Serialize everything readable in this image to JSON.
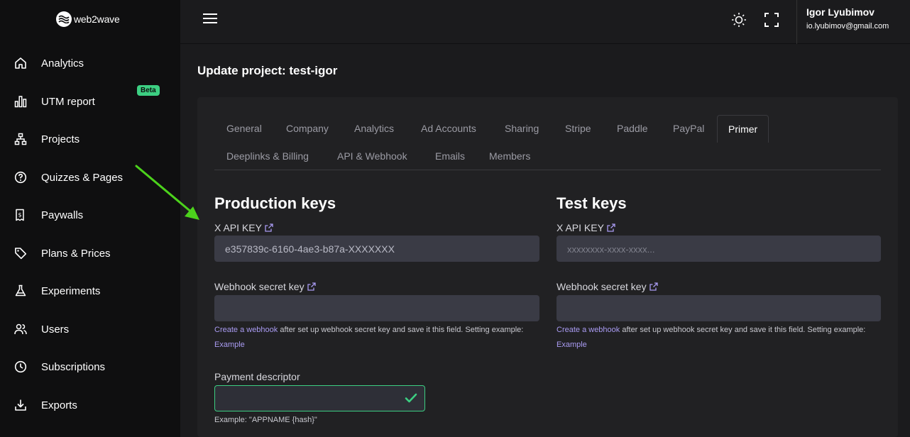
{
  "brand": {
    "name": "web2wave"
  },
  "sidebar": {
    "items": [
      {
        "label": "Analytics",
        "icon": "home-icon"
      },
      {
        "label": "UTM report",
        "icon": "bar-chart-icon",
        "badge": "Beta"
      },
      {
        "label": "Projects",
        "icon": "sitemap-icon"
      },
      {
        "label": "Quizzes & Pages",
        "icon": "question-circle-icon"
      },
      {
        "label": "Paywalls",
        "icon": "receipt-icon"
      },
      {
        "label": "Plans & Prices",
        "icon": "tag-icon"
      },
      {
        "label": "Experiments",
        "icon": "flask-icon"
      },
      {
        "label": "Users",
        "icon": "users-icon"
      },
      {
        "label": "Subscriptions",
        "icon": "clock-icon"
      },
      {
        "label": "Exports",
        "icon": "download-icon"
      }
    ]
  },
  "user": {
    "name": "Igor Lyubimov",
    "email": "io.lyubimov@gmail.com"
  },
  "page": {
    "title": "Update project: test-igor"
  },
  "tabs": {
    "row1": [
      "General",
      "Company",
      "Analytics",
      "Ad Accounts",
      "Sharing",
      "Stripe",
      "Paddle",
      "PayPal",
      "Primer"
    ],
    "row2": [
      "Deeplinks & Billing",
      "API & Webhook",
      "Emails",
      "Members"
    ],
    "active": "Primer"
  },
  "production": {
    "heading": "Production keys",
    "api_key_label": "X API KEY",
    "api_key_value": "e357839c-6160-4ae3-b87a-XXXXXXX",
    "webhook_label": "Webhook secret key",
    "webhook_value": "",
    "help_link": "Create a webhook",
    "help_text": " after set up webhook secret key and save it this field. Setting example: ",
    "example_link": "Example",
    "descriptor_label": "Payment descriptor",
    "descriptor_value": "",
    "descriptor_hint": "Example: \"APPNAME {hash}\""
  },
  "test": {
    "heading": "Test keys",
    "api_key_label": "X API KEY",
    "api_key_placeholder": "xxxxxxxx-xxxx-xxxx...",
    "webhook_label": "Webhook secret key",
    "webhook_value": "",
    "help_link": "Create a webhook",
    "help_text": " after set up webhook secret key and save it this field. Setting example: ",
    "example_link": "Example"
  },
  "colors": {
    "accent_green": "#3ccf82",
    "link_purple": "#a99bf2",
    "arrow_green": "#4cd21c"
  }
}
